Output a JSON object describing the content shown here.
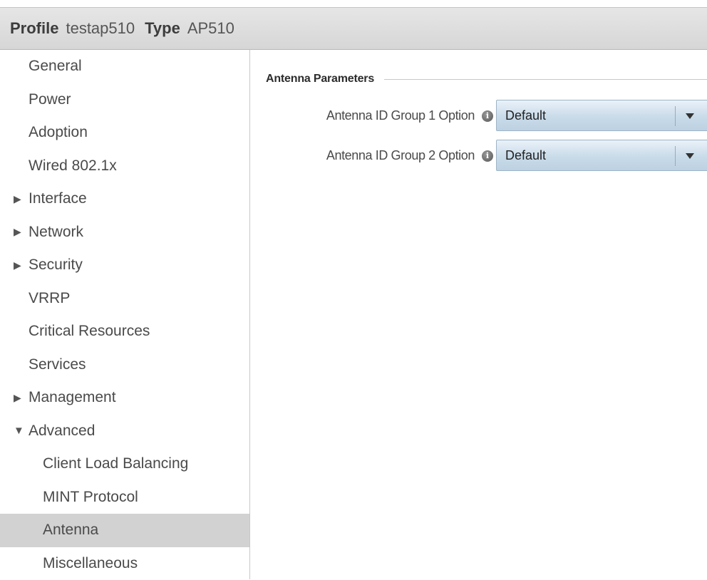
{
  "header": {
    "profile_key": "Profile",
    "profile_value": "testap510",
    "type_key": "Type",
    "type_value": "AP510"
  },
  "sidebar": {
    "items": [
      {
        "label": "General",
        "expander": "none",
        "level": 0
      },
      {
        "label": "Power",
        "expander": "none",
        "level": 0
      },
      {
        "label": "Adoption",
        "expander": "none",
        "level": 0
      },
      {
        "label": "Wired 802.1x",
        "expander": "none",
        "level": 0
      },
      {
        "label": "Interface",
        "expander": "collapsed",
        "level": 0
      },
      {
        "label": "Network",
        "expander": "collapsed",
        "level": 0
      },
      {
        "label": "Security",
        "expander": "collapsed",
        "level": 0
      },
      {
        "label": "VRRP",
        "expander": "none",
        "level": 0
      },
      {
        "label": "Critical Resources",
        "expander": "none",
        "level": 0
      },
      {
        "label": "Services",
        "expander": "none",
        "level": 0
      },
      {
        "label": "Management",
        "expander": "collapsed",
        "level": 0
      },
      {
        "label": "Advanced",
        "expander": "expanded",
        "level": 0
      },
      {
        "label": "Client Load Balancing",
        "expander": "none",
        "level": 1
      },
      {
        "label": "MINT Protocol",
        "expander": "none",
        "level": 1
      },
      {
        "label": "Antenna",
        "expander": "none",
        "level": 1,
        "selected": true
      },
      {
        "label": "Miscellaneous",
        "expander": "none",
        "level": 1
      }
    ],
    "collapsed_icon": "triangle-right-icon",
    "expanded_icon": "triangle-down-icon",
    "selected_color": "#d2d2d2"
  },
  "main": {
    "section_title": "Antenna Parameters",
    "fields": [
      {
        "label": "Antenna ID Group 1 Option",
        "info_icon": "info-icon",
        "value": "Default"
      },
      {
        "label": "Antenna ID Group 2 Option",
        "info_icon": "info-icon",
        "value": "Default"
      }
    ]
  },
  "colors": {
    "header_bg": "#dcdcdc",
    "select_bg": "#c9dbe9",
    "select_border": "#9eb4c7"
  }
}
